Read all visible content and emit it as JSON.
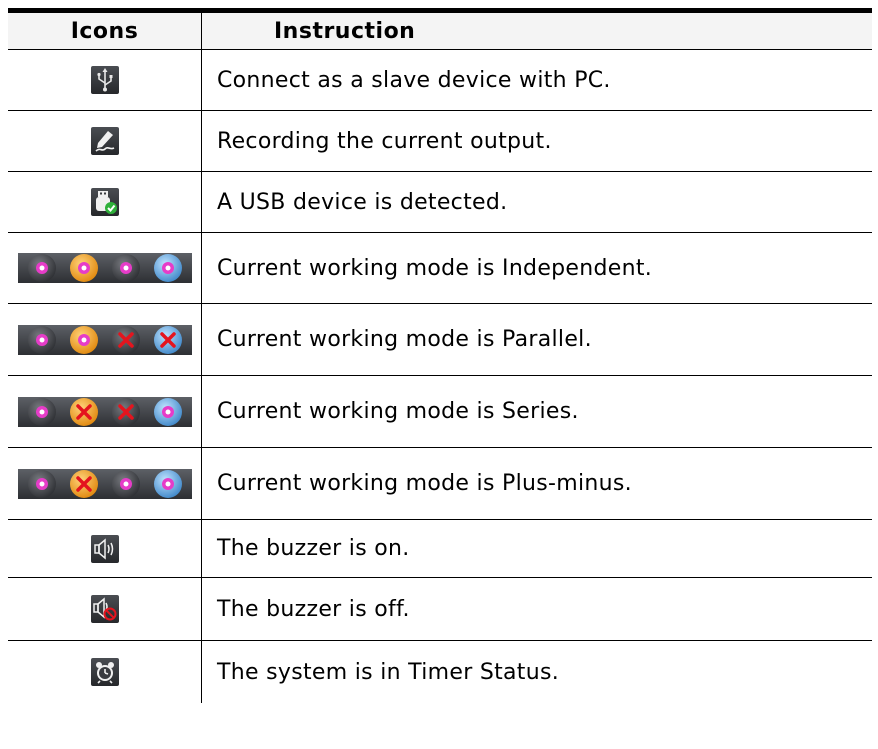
{
  "table": {
    "header": {
      "icons": "Icons",
      "instruction": "Instruction"
    },
    "rows": [
      {
        "icon": "usb-icon",
        "text": "Connect as a slave device with PC."
      },
      {
        "icon": "recording-pen-icon",
        "text": "Recording the current output."
      },
      {
        "icon": "usb-device-detected-icon",
        "text": "A USB device is detected."
      },
      {
        "icon": "mode-independent-icon",
        "text": "Current working mode is Independent."
      },
      {
        "icon": "mode-parallel-icon",
        "text": "Current working mode is Parallel."
      },
      {
        "icon": "mode-series-icon",
        "text": "Current working mode is Series."
      },
      {
        "icon": "mode-plus-minus-icon",
        "text": "Current working mode is Plus-minus."
      },
      {
        "icon": "buzzer-on-icon",
        "text": "The buzzer is on."
      },
      {
        "icon": "buzzer-off-icon",
        "text": "The buzzer is off."
      },
      {
        "icon": "timer-alarm-clock-icon",
        "text": "The system is in Timer Status."
      }
    ]
  },
  "colors": {
    "magenta": "#e63cc8",
    "orange": "#f2a21a",
    "blue": "#5ba8e0",
    "dark": "#3a3c40",
    "cross": "#e4141e",
    "check": "#2fb03a"
  }
}
